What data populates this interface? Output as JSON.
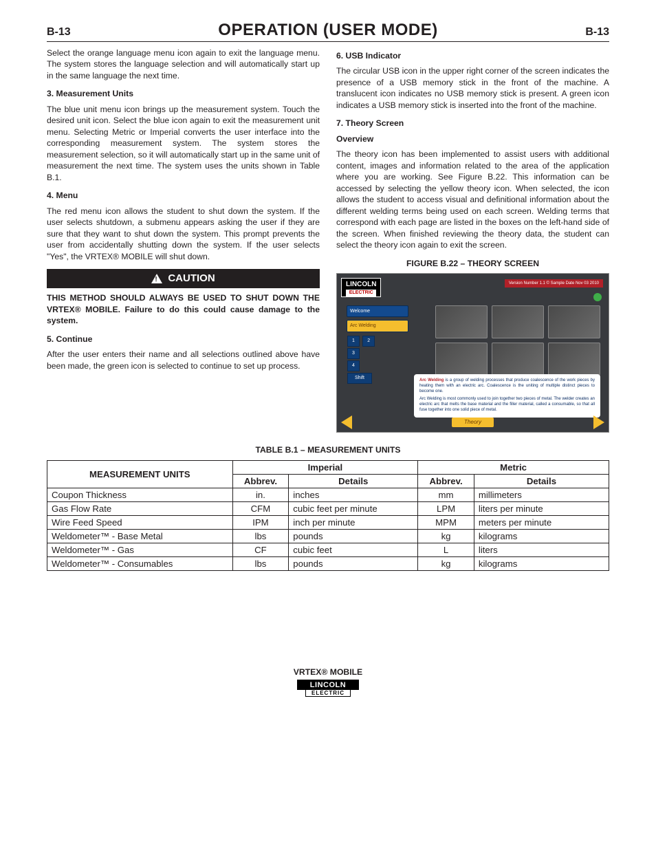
{
  "header": {
    "left": "B-13",
    "title": "OPERATION (USER MODE)",
    "right": "B-13"
  },
  "left_col": {
    "intro": "Select the orange language menu icon again to exit the language menu.  The system stores the language selection and will automatically start up in the same language the next time.",
    "s3_head": "3.  Measurement Units",
    "s3_body": "The blue unit menu icon brings up the measurement system.  Touch the desired unit icon.  Select the blue icon again to exit the measurement unit menu.  Selecting Metric or Imperial converts the user interface into the corresponding measurement system.  The system stores the measurement selection, so it will automatically start up in the same unit of measurement the next time.  The system uses the units shown in Table B.1.",
    "s4_head": "4.  Menu",
    "s4_body": "The red menu icon allows the student to shut down the system.  If the user selects shutdown, a submenu appears asking the user if they are sure that they want to shut down the system.  This prompt prevents the user from accidentally shutting down the system.  If the user selects \"Yes\", the VRTEX® MOBILE will shut down.",
    "caution_label": "CAUTION",
    "caution_body": "THIS METHOD SHOULD ALWAYS BE USED TO SHUT DOWN THE VRTEX® MOBILE.  Failure to do this could cause damage to the system.",
    "s5_head": "5. Continue",
    "s5_body": "After the user enters their name and all selections outlined above have been made, the green icon is selected to continue to set up process."
  },
  "right_col": {
    "s6_head": "6. USB Indicator",
    "s6_body": "The circular USB icon in the upper right corner of the screen indicates the presence of a USB memory stick in the front of the machine. A translucent icon indicates no USB memory stick is present. A green icon indicates a USB memory stick is inserted into the front of the machine.",
    "s7_head": "7. Theory Screen",
    "overview_head": "Overview",
    "s7_body": "The theory icon has been implemented to assist users with additional content, images and information related to the area of the application where you are working.  See Figure B.22.  This information can be accessed by selecting the yellow theory icon.  When selected, the icon allows the student to access visual and definitional information about the different welding terms being used on each screen.  Welding terms that correspond with each page are listed in the boxes on the left-hand side of the screen.  When finished reviewing the theory data, the student can select the theory icon again to exit the screen.",
    "fig_caption": "FIGURE B.22 – THEORY SCREEN",
    "fig": {
      "brand_top": "LINCOLN",
      "brand_bot": "ELECTRIC",
      "version": "Version Number 1.1 © Sample Date Nov 03 2010",
      "side_btn1": "Welcome",
      "side_btn2": "Arc Welding",
      "keys": [
        "1",
        "2",
        "3",
        "4",
        "Shift"
      ],
      "desc_hl": "Arc Welding",
      "desc1": " is a group of welding processes that produce coalescence of the work pieces by heating them with an electric arc. Coalescence is the uniting of multiple distinct pieces to become one.",
      "desc2": "Arc Welding is most commonly used to join together two pieces of metal. The welder creates an electric arc that melts the base material and the filler material, called a consumable, so that all fuse together into one solid piece of metal.",
      "theory_label": "Theory"
    }
  },
  "table": {
    "caption": "TABLE B.1 – MEASUREMENT UNITS",
    "head_main": "MEASUREMENT UNITS",
    "head_imp": "Imperial",
    "head_met": "Metric",
    "head_abbr": "Abbrev.",
    "head_det": "Details",
    "rows": [
      {
        "name": "Coupon Thickness",
        "ia": "in.",
        "id": "inches",
        "ma": "mm",
        "md": "millimeters"
      },
      {
        "name": "Gas Flow Rate",
        "ia": "CFM",
        "id": "cubic feet per minute",
        "ma": "LPM",
        "md": "liters per minute"
      },
      {
        "name": "Wire Feed Speed",
        "ia": "IPM",
        "id": "inch per minute",
        "ma": "MPM",
        "md": "meters per minute"
      },
      {
        "name": "Weldometer™ - Base Metal",
        "ia": "lbs",
        "id": "pounds",
        "ma": "kg",
        "md": "kilograms"
      },
      {
        "name": "Weldometer™ - Gas",
        "ia": "CF",
        "id": "cubic feet",
        "ma": "L",
        "md": "liters"
      },
      {
        "name": "Weldometer™ - Consumables",
        "ia": "lbs",
        "id": "pounds",
        "ma": "kg",
        "md": "kilograms"
      }
    ]
  },
  "footer": {
    "product": "VRTEX® MOBILE",
    "brand_top": "LINCOLN",
    "brand_bot": "ELECTRIC"
  }
}
